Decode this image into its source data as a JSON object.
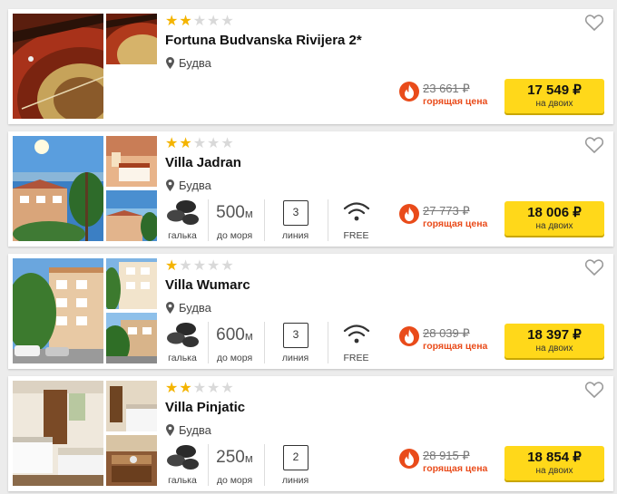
{
  "hotels": [
    {
      "name": "Fortuna Budvanska Rivijera 2*",
      "location": "Будва",
      "stars_filled": 2,
      "stars_total": 5,
      "old_price": "23 661 ₽",
      "hot_label": "горящая цена",
      "price": "17 549 ₽",
      "price_note": "на двоих"
    },
    {
      "name": "Villa Jadran",
      "location": "Будва",
      "stars_filled": 2,
      "stars_total": 5,
      "beach_type": "галька",
      "distance_value": "500",
      "distance_unit": "м",
      "distance_label": "до моря",
      "line_value": "3",
      "line_label": "линия",
      "wifi_label": "FREE",
      "old_price": "27 773 ₽",
      "hot_label": "горящая цена",
      "price": "18 006 ₽",
      "price_note": "на двоих"
    },
    {
      "name": "Villa Wumarc",
      "location": "Будва",
      "stars_filled": 1,
      "stars_total": 5,
      "beach_type": "галька",
      "distance_value": "600",
      "distance_unit": "м",
      "distance_label": "до моря",
      "line_value": "3",
      "line_label": "линия",
      "wifi_label": "FREE",
      "old_price": "28 039 ₽",
      "hot_label": "горящая цена",
      "price": "18 397 ₽",
      "price_note": "на двоих"
    },
    {
      "name": "Villa Pinjatic",
      "location": "Будва",
      "stars_filled": 2,
      "stars_total": 5,
      "beach_type": "галька",
      "distance_value": "250",
      "distance_unit": "м",
      "distance_label": "до моря",
      "line_value": "2",
      "line_label": "линия",
      "old_price": "28 915 ₽",
      "hot_label": "горящая цена",
      "price": "18 854 ₽",
      "price_note": "на двоих"
    }
  ],
  "colors": {
    "star_on": "#f4b400",
    "star_off": "#d9d9d9",
    "hot": "#e94b1a",
    "price_button": "#ffd81a"
  },
  "icons": [
    "star-icon",
    "map-pin-icon",
    "pebbles-icon",
    "wifi-icon",
    "fire-icon",
    "heart-icon"
  ]
}
